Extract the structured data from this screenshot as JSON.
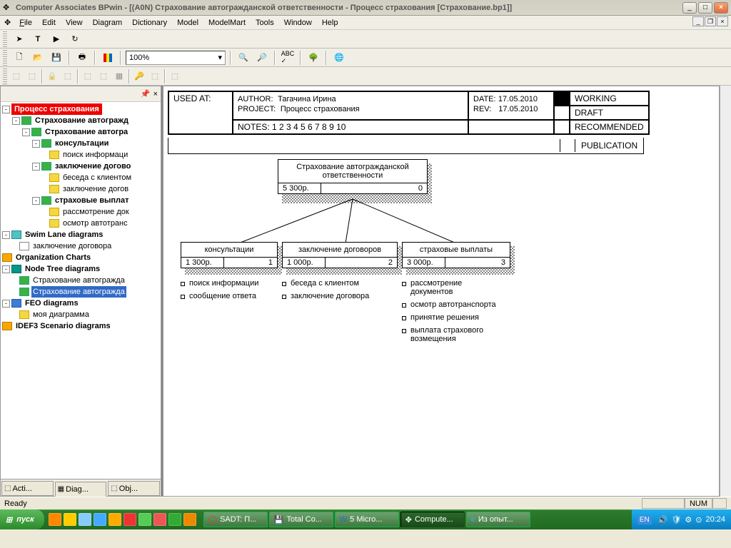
{
  "window": {
    "title": "Computer Associates BPwin - [(A0N) Страхование автогражданской  ответственности - Процесс страхования  [Страхование.bp1]]"
  },
  "menu": {
    "file": "File",
    "edit": "Edit",
    "view": "View",
    "diagram": "Diagram",
    "dictionary": "Dictionary",
    "model": "Model",
    "modelmart": "ModelMart",
    "tools": "Tools",
    "window": "Window",
    "help": "Help"
  },
  "zoom": "100%",
  "tree": {
    "root": "Процесс страхования",
    "n1": "Страхование автогражд",
    "n2": "Страхование автогра",
    "n3": "консультации",
    "n3a": "поиск информаци",
    "n4": "заключение догово",
    "n4a": "беседа с клиентом",
    "n4b": "заключение догов",
    "n5": "страховые выплат",
    "n5a": "рассмотрение док",
    "n5b": "осмотр  автотранс",
    "swim": "Swim Lane diagrams",
    "swim1": "заключение договора",
    "org": "Organization Charts",
    "nodetree": "Node Tree diagrams",
    "nt1": "Страхование автогражда",
    "nt2": "Страхование автогражда",
    "feo": "FEO diagrams",
    "feo1": "моя диаграмма",
    "idef3": "IDEF3 Scenario diagrams"
  },
  "sidetabs": {
    "acti": "Acti...",
    "diag": "Diag...",
    "obj": "Obj..."
  },
  "header": {
    "used_at": "USED AT:",
    "author_lbl": "AUTHOR:",
    "author": "Тагачина Ирина",
    "project_lbl": "PROJECT:",
    "project": "Процесс страхования",
    "date_lbl": "DATE:",
    "date": "17.05.2010",
    "rev_lbl": "REV:",
    "rev": "17.05.2010",
    "notes": "NOTES:  1  2  3  4  5  6  7  8  9  10",
    "working": "WORKING",
    "draft": "DRAFT",
    "recommended": "RECOMMENDED",
    "publication": "PUBLICATION"
  },
  "chart_data": {
    "type": "tree",
    "root": {
      "title": "Страхование автогражданской ответственности",
      "cost": "5 300р.",
      "index": "0"
    },
    "children": [
      {
        "title": "консультации",
        "cost": "1 300р.",
        "index": "1",
        "bullets": [
          "поиск информации",
          "сообщение ответа"
        ]
      },
      {
        "title": "заключение договоров",
        "cost": "1 000р.",
        "index": "2",
        "bullets": [
          "беседа с клиентом",
          "заключение договора"
        ]
      },
      {
        "title": "страховые выплаты",
        "cost": "3 000р.",
        "index": "3",
        "bullets": [
          "рассмотрение документов",
          "осмотр автотранспорта",
          "принятие решения",
          "выплата страхового возмещения"
        ]
      }
    ]
  },
  "status": {
    "ready": "Ready",
    "num": "NUM"
  },
  "taskbar": {
    "start": "пуск",
    "tasks": [
      {
        "label": "SADT: П...",
        "active": false
      },
      {
        "label": "Total Co...",
        "active": false
      },
      {
        "label": "5 Micro...",
        "active": false
      },
      {
        "label": "Compute...",
        "active": true
      },
      {
        "label": "Из опыт...",
        "active": false
      }
    ],
    "lang": "EN",
    "time": "20:24"
  }
}
